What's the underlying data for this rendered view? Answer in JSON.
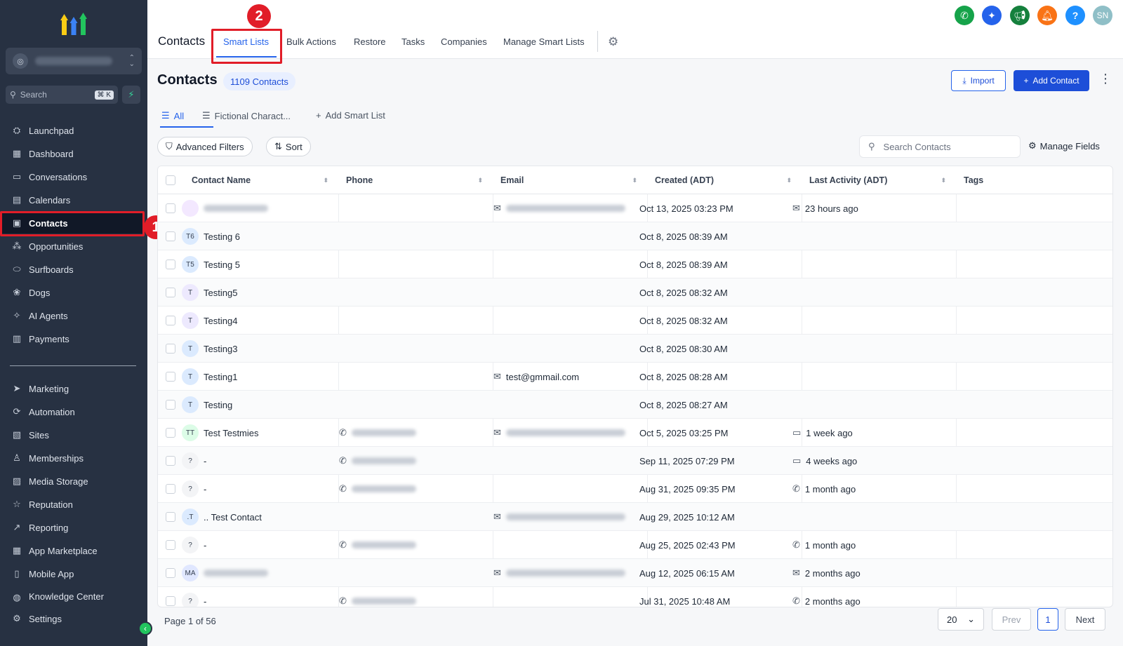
{
  "sidebar": {
    "search_placeholder": "Search",
    "search_shortcut": "⌘ K",
    "nav": [
      {
        "label": "Launchpad",
        "icon": "rocket-icon"
      },
      {
        "label": "Dashboard",
        "icon": "dashboard-icon"
      },
      {
        "label": "Conversations",
        "icon": "chat-icon"
      },
      {
        "label": "Calendars",
        "icon": "calendar-icon"
      },
      {
        "label": "Contacts",
        "icon": "contacts-icon",
        "active": true
      },
      {
        "label": "Opportunities",
        "icon": "opportunities-icon"
      },
      {
        "label": "Surfboards",
        "icon": "surfboard-icon"
      },
      {
        "label": "Dogs",
        "icon": "dog-icon"
      },
      {
        "label": "AI Agents",
        "icon": "sparkle-icon"
      },
      {
        "label": "Payments",
        "icon": "payments-icon"
      }
    ],
    "nav2": [
      {
        "label": "Marketing",
        "icon": "send-icon"
      },
      {
        "label": "Automation",
        "icon": "automation-icon"
      },
      {
        "label": "Sites",
        "icon": "sites-icon"
      },
      {
        "label": "Memberships",
        "icon": "memberships-icon"
      },
      {
        "label": "Media Storage",
        "icon": "media-icon"
      },
      {
        "label": "Reputation",
        "icon": "star-icon"
      },
      {
        "label": "Reporting",
        "icon": "chart-icon"
      },
      {
        "label": "App Marketplace",
        "icon": "apps-icon"
      },
      {
        "label": "Mobile App",
        "icon": "mobile-icon"
      },
      {
        "label": "Knowledge Center",
        "icon": "globe-icon"
      }
    ],
    "settings_label": "Settings"
  },
  "markers": {
    "one": "1",
    "two": "2"
  },
  "topbar": {
    "title": "Contacts",
    "tabs": [
      "Smart Lists",
      "Bulk Actions",
      "Restore",
      "Tasks",
      "Companies",
      "Manage Smart Lists"
    ],
    "user_initials": "SN",
    "help": "?"
  },
  "main": {
    "title": "Contacts",
    "count": "1109 Contacts",
    "import_label": "Import",
    "add_contact_label": "Add Contact",
    "list_tabs": [
      "All",
      "Fictional Charact...",
      "Add Smart List"
    ],
    "advanced_filters": "Advanced Filters",
    "sort": "Sort",
    "search_placeholder": "Search Contacts",
    "manage_fields": "Manage Fields"
  },
  "table": {
    "columns": [
      "Contact Name",
      "Phone",
      "Email",
      "Created (ADT)",
      "Last Activity (ADT)",
      "Tags"
    ],
    "rows": [
      {
        "initials": "",
        "name": "",
        "name_blur": true,
        "phone": false,
        "email": "",
        "email_blur": true,
        "created": "Oct 13, 2025 03:23 PM",
        "activity": "23 hours ago",
        "activity_icon": "mail-icon"
      },
      {
        "initials": "T6",
        "name": "Testing 6",
        "phone": false,
        "email": "",
        "created": "Oct 8, 2025 08:39 AM",
        "activity": ""
      },
      {
        "initials": "T5",
        "name": "Testing 5",
        "phone": false,
        "email": "",
        "created": "Oct 8, 2025 08:39 AM",
        "activity": ""
      },
      {
        "initials": "T",
        "name": "Testing5",
        "phone": false,
        "email": "",
        "created": "Oct 8, 2025 08:32 AM",
        "activity": ""
      },
      {
        "initials": "T",
        "name": "Testing4",
        "phone": false,
        "email": "",
        "created": "Oct 8, 2025 08:32 AM",
        "activity": ""
      },
      {
        "initials": "T",
        "name": "Testing3",
        "phone": false,
        "email": "",
        "created": "Oct 8, 2025 08:30 AM",
        "activity": ""
      },
      {
        "initials": "T",
        "name": "Testing1",
        "phone": false,
        "email": "test@gmmail.com",
        "created": "Oct 8, 2025 08:28 AM",
        "activity": ""
      },
      {
        "initials": "T",
        "name": "Testing",
        "phone": false,
        "email": "",
        "created": "Oct 8, 2025 08:27 AM",
        "activity": ""
      },
      {
        "initials": "TT",
        "name": "Test Testmies",
        "phone": true,
        "email": "",
        "email_blur": true,
        "created": "Oct 5, 2025 03:25 PM",
        "activity": "1 week ago",
        "activity_icon": "chat-icon"
      },
      {
        "initials": "?",
        "name": "-",
        "phone": true,
        "email": "",
        "created": "Sep 11, 2025 07:29 PM",
        "activity": "4 weeks ago",
        "activity_icon": "chat-icon"
      },
      {
        "initials": "?",
        "name": "-",
        "phone": true,
        "email": "",
        "created": "Aug 31, 2025 09:35 PM",
        "activity": "1 month ago",
        "activity_icon": "phone-icon"
      },
      {
        "initials": ".T",
        "name": ".. Test Contact",
        "phone": false,
        "email": "",
        "email_blur": true,
        "created": "Aug 29, 2025 10:12 AM",
        "activity": ""
      },
      {
        "initials": "?",
        "name": "-",
        "phone": true,
        "email": "",
        "created": "Aug 25, 2025 02:43 PM",
        "activity": "1 month ago",
        "activity_icon": "phone-icon"
      },
      {
        "initials": "MA",
        "name": "",
        "name_blur": true,
        "phone": false,
        "email": "",
        "email_blur": true,
        "created": "Aug 12, 2025 06:15 AM",
        "activity": "2 months ago",
        "activity_icon": "mail-icon"
      },
      {
        "initials": "?",
        "name": "-",
        "phone": true,
        "email": "",
        "created": "Jul 31, 2025 10:48 AM",
        "activity": "2 months ago",
        "activity_icon": "phone-icon"
      }
    ]
  },
  "pagination": {
    "info": "Page 1 of 56",
    "page_size": "20",
    "prev": "Prev",
    "current": "1",
    "next": "Next"
  },
  "colors": {
    "accent": "#1d4ed8",
    "sidebar_bg": "#273142",
    "highlight": "#e11d28"
  }
}
